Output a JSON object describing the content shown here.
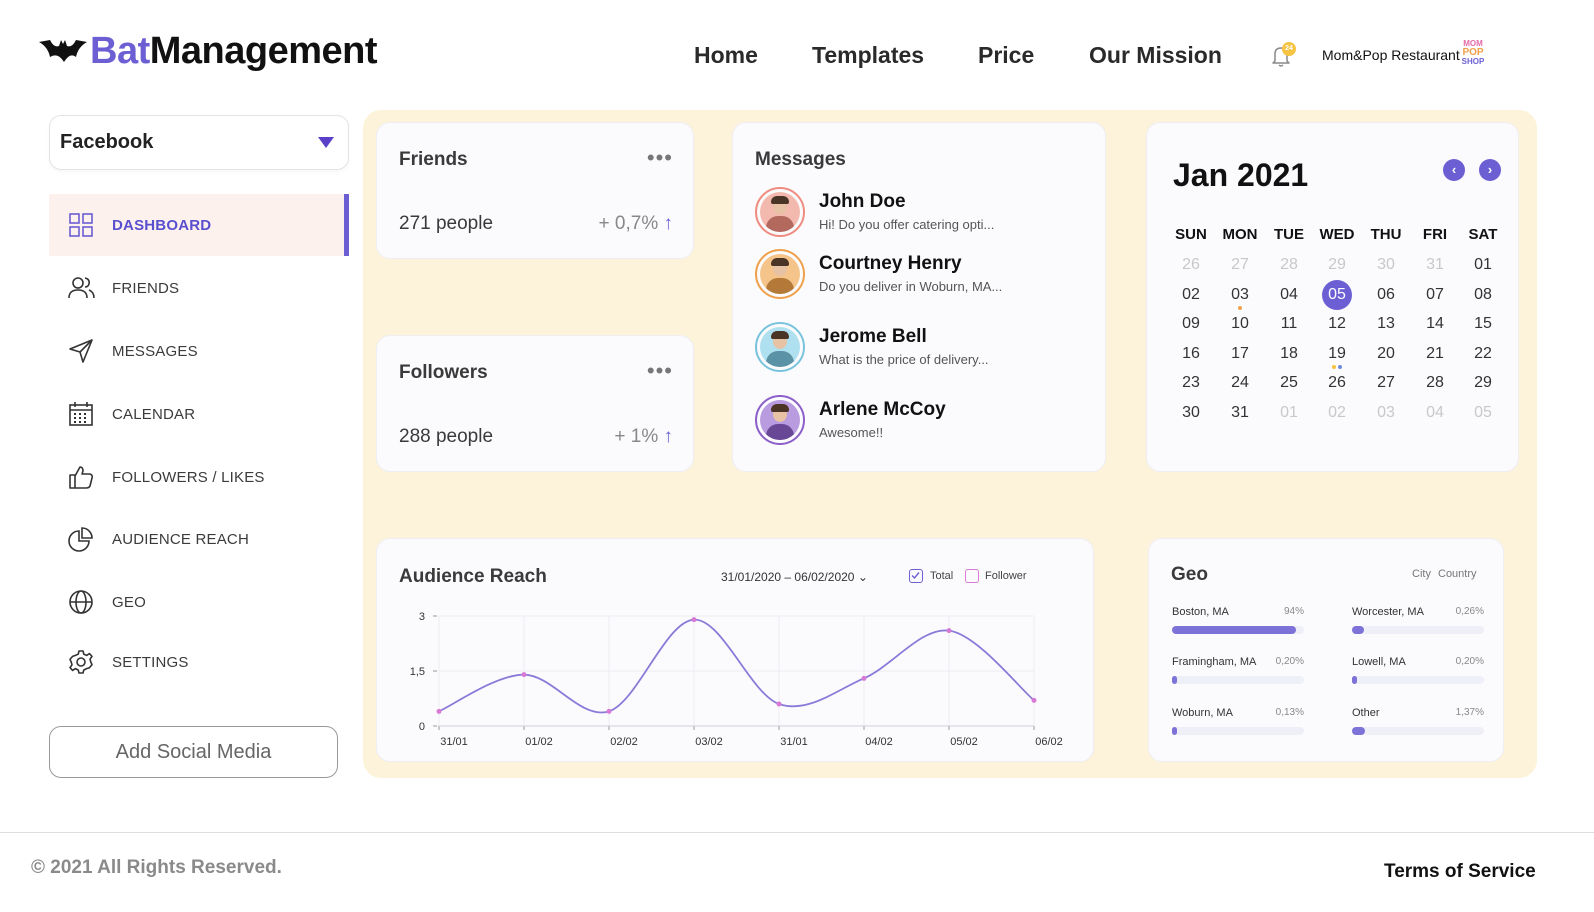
{
  "brand": {
    "part1": "Bat",
    "part2": "Management",
    "accent": "#6b5fd3"
  },
  "nav": {
    "home": "Home",
    "templates": "Templates",
    "price": "Price",
    "mission": "Our Mission"
  },
  "notifications": {
    "count": "24"
  },
  "account": {
    "name": "Mom&Pop Restaurant",
    "logo_text": [
      "MOM",
      "POP",
      "SHOP"
    ]
  },
  "sidebar": {
    "platform": "Facebook",
    "items": [
      {
        "label": "DASHBOARD",
        "icon": "grid-icon"
      },
      {
        "label": "FRIENDS",
        "icon": "users-icon"
      },
      {
        "label": "MESSAGES",
        "icon": "send-icon"
      },
      {
        "label": "CALENDAR",
        "icon": "calendar-icon"
      },
      {
        "label": "FOLLOWERS / LIKES",
        "icon": "thumbs-up-icon"
      },
      {
        "label": "AUDIENCE REACH",
        "icon": "pie-chart-icon"
      },
      {
        "label": "GEO",
        "icon": "globe-icon"
      },
      {
        "label": "SETTINGS",
        "icon": "gear-icon"
      }
    ],
    "add_button": "Add Social Media"
  },
  "friends": {
    "title": "Friends",
    "value": "271 people",
    "change": "+ 0,7%",
    "arrow": "↑"
  },
  "followers": {
    "title": "Followers",
    "value": "288 people",
    "change": "+ 1%",
    "arrow": "↑"
  },
  "messages": {
    "title": "Messages",
    "items": [
      {
        "name": "John Doe",
        "text": "Hi! Do you offer catering opti...",
        "ring": "#ef8c7e",
        "bg": "#f4b9ae"
      },
      {
        "name": "Courtney Henry",
        "text": "Do you deliver in Woburn, MA...",
        "ring": "#f0a04b",
        "bg": "#f5c48a"
      },
      {
        "name": "Jerome Bell",
        "text": "What is the price of delivery...",
        "ring": "#7ac3dc",
        "bg": "#aee0ef"
      },
      {
        "name": "Arlene McCoy",
        "text": "Awesome!!",
        "ring": "#8c5fc9",
        "bg": "#b99be0"
      }
    ]
  },
  "calendar": {
    "title": "Jan 2021",
    "prev": "‹",
    "next": "›",
    "weekdays": [
      "SUN",
      "MON",
      "TUE",
      "WED",
      "THU",
      "FRI",
      "SAT"
    ],
    "weeks": [
      [
        "26",
        "27",
        "28",
        "29",
        "30",
        "31",
        "01"
      ],
      [
        "02",
        "03",
        "04",
        "05",
        "06",
        "07",
        "08"
      ],
      [
        "09",
        "10",
        "11",
        "12",
        "13",
        "14",
        "15"
      ],
      [
        "16",
        "17",
        "18",
        "19",
        "20",
        "21",
        "22"
      ],
      [
        "23",
        "24",
        "25",
        "26",
        "27",
        "28",
        "29"
      ],
      [
        "30",
        "31",
        "01",
        "02",
        "03",
        "04",
        "05"
      ]
    ],
    "selected": "05"
  },
  "audience": {
    "title": "Audience Reach",
    "range": "31/01/2020 – 06/02/2020",
    "legend_total": "Total",
    "legend_follower": "Follower"
  },
  "chart_data": {
    "type": "line",
    "categories": [
      "31/01",
      "01/02",
      "02/02",
      "03/02",
      "31/01",
      "04/02",
      "05/02",
      "06/02"
    ],
    "series": [
      {
        "name": "Total",
        "values": [
          0.4,
          1.4,
          0.4,
          2.9,
          0.6,
          1.3,
          2.6,
          0.7
        ]
      }
    ],
    "yticks": [
      "0",
      "1,5",
      "3"
    ],
    "ylim": [
      0,
      3
    ],
    "grid": true,
    "color": "#8b7ad8"
  },
  "geo": {
    "title": "Geo",
    "tab_city": "City",
    "tab_country": "Country",
    "items": [
      {
        "name": "Boston, MA",
        "pct": "94%",
        "fill": 0.94
      },
      {
        "name": "Worcester, MA",
        "pct": "0,26%",
        "fill": 0.09
      },
      {
        "name": "Framingham, MA",
        "pct": "0,20%",
        "fill": 0.04
      },
      {
        "name": "Lowell, MA",
        "pct": "0,20%",
        "fill": 0.04
      },
      {
        "name": "Woburn, MA",
        "pct": "0,13%",
        "fill": 0.03
      },
      {
        "name": "Other",
        "pct": "1,37%",
        "fill": 0.1
      }
    ]
  },
  "footer": {
    "copyright": "© 2021 All Rights Reserved.",
    "terms": "Terms of Service"
  }
}
